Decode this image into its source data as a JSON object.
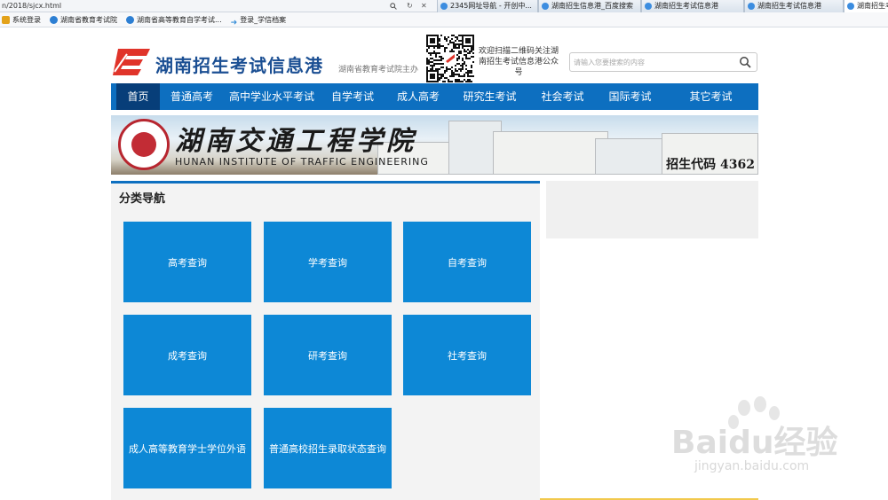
{
  "browser": {
    "url": "n/2018/sjcx.html",
    "tabs": [
      {
        "label": "2345网址导航 - 开创中...",
        "width": 114
      },
      {
        "label": "湖南招生信息港_百度搜索",
        "width": 116
      },
      {
        "label": "湖南招生考试信息港",
        "width": 116
      },
      {
        "label": "湖南招生考试信息港",
        "width": 112
      },
      {
        "label": "湖南招生考试",
        "width": 60
      }
    ],
    "favorites": [
      {
        "label": "系统登录",
        "icon": "folder-icon"
      },
      {
        "label": "湖南省教育考试院",
        "icon": "ie-icon"
      },
      {
        "label": "湖南省高等教育自学考试...",
        "icon": "ie-icon"
      },
      {
        "label": "登录_学信档案",
        "icon": "arrow-icon"
      }
    ]
  },
  "header": {
    "logo_text": "湖南招生考试信息港",
    "host": "湖南省教育考试院主办",
    "qr_text": "欢迎扫描二维码关注湖南招生考试信息港公众号",
    "search_placeholder": "请输入您要搜索的内容"
  },
  "nav": {
    "items": [
      {
        "label": "首页",
        "active": true
      },
      {
        "label": "普通高考"
      },
      {
        "label": "高中学业水平考试"
      },
      {
        "label": "自学考试"
      },
      {
        "label": "成人高考"
      },
      {
        "label": "研究生考试"
      },
      {
        "label": "社会考试"
      },
      {
        "label": "国际考试"
      },
      {
        "label": "其它考试"
      }
    ]
  },
  "banner": {
    "title": "湖南交通工程学院",
    "subtitle": "HUNAN INSTITUTE OF TRAFFIC ENGINEERING",
    "code": "招生代码 4362"
  },
  "panel": {
    "title": "分类导航",
    "tiles": [
      "高考查询",
      "学考查询",
      "自考查询",
      "成考查询",
      "研考查询",
      "社考查询",
      "成人高等教育学士学位外语",
      "普通高校招生录取状态查询"
    ]
  },
  "watermark": {
    "brand": "Baidu经验",
    "url": "jingyan.baidu.com"
  },
  "colors": {
    "nav_blue": "#0d6fc0",
    "nav_active": "#073e79",
    "tile_blue": "#0d88d6",
    "logo_red": "#e0342a"
  }
}
